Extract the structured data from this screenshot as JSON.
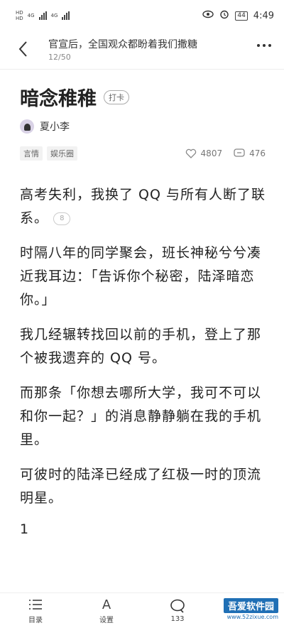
{
  "status_bar": {
    "network_1": "HD",
    "network_2": "HD",
    "signal_label_1": "4G",
    "signal_label_2": "4G",
    "battery": "44",
    "time": "4:49"
  },
  "nav": {
    "title": "官宣后，全国观众都盼着我们撒糖",
    "progress": "12/50"
  },
  "story": {
    "title": "暗念稚稚",
    "badge": "打卡",
    "author": "夏小李",
    "tags": [
      "言情",
      "娱乐圈"
    ],
    "likes": "4807",
    "comments": "476"
  },
  "content": {
    "para1": "高考失利，我换了 QQ 与所有人断了联系。",
    "para1_comment_count": "8",
    "para2": "时隔八年的同学聚会，班长神秘兮兮凑近我耳边：「告诉你个秘密，陆泽暗恋你。」",
    "para3": "我几经辗转找回以前的手机，登上了那个被我遗弃的 QQ 号。",
    "para4": "而那条「你想去哪所大学，我可不可以和你一起？」的消息静静躺在我的手机里。",
    "para5": "可彼时的陆泽已经成了红极一时的顶流明星。",
    "chapter_number": "1"
  },
  "bottom_bar": {
    "catalog_label": "目录",
    "settings_label": "设置",
    "settings_icon_glyph": "A",
    "comments_count": "133"
  },
  "watermark": {
    "title": "吾爱软件园",
    "url": "www.52zixue.com"
  },
  "colors": {
    "background": "#ffffff",
    "text": "#222222",
    "muted": "#888888",
    "watermark_blue": "#1f6fb5"
  }
}
